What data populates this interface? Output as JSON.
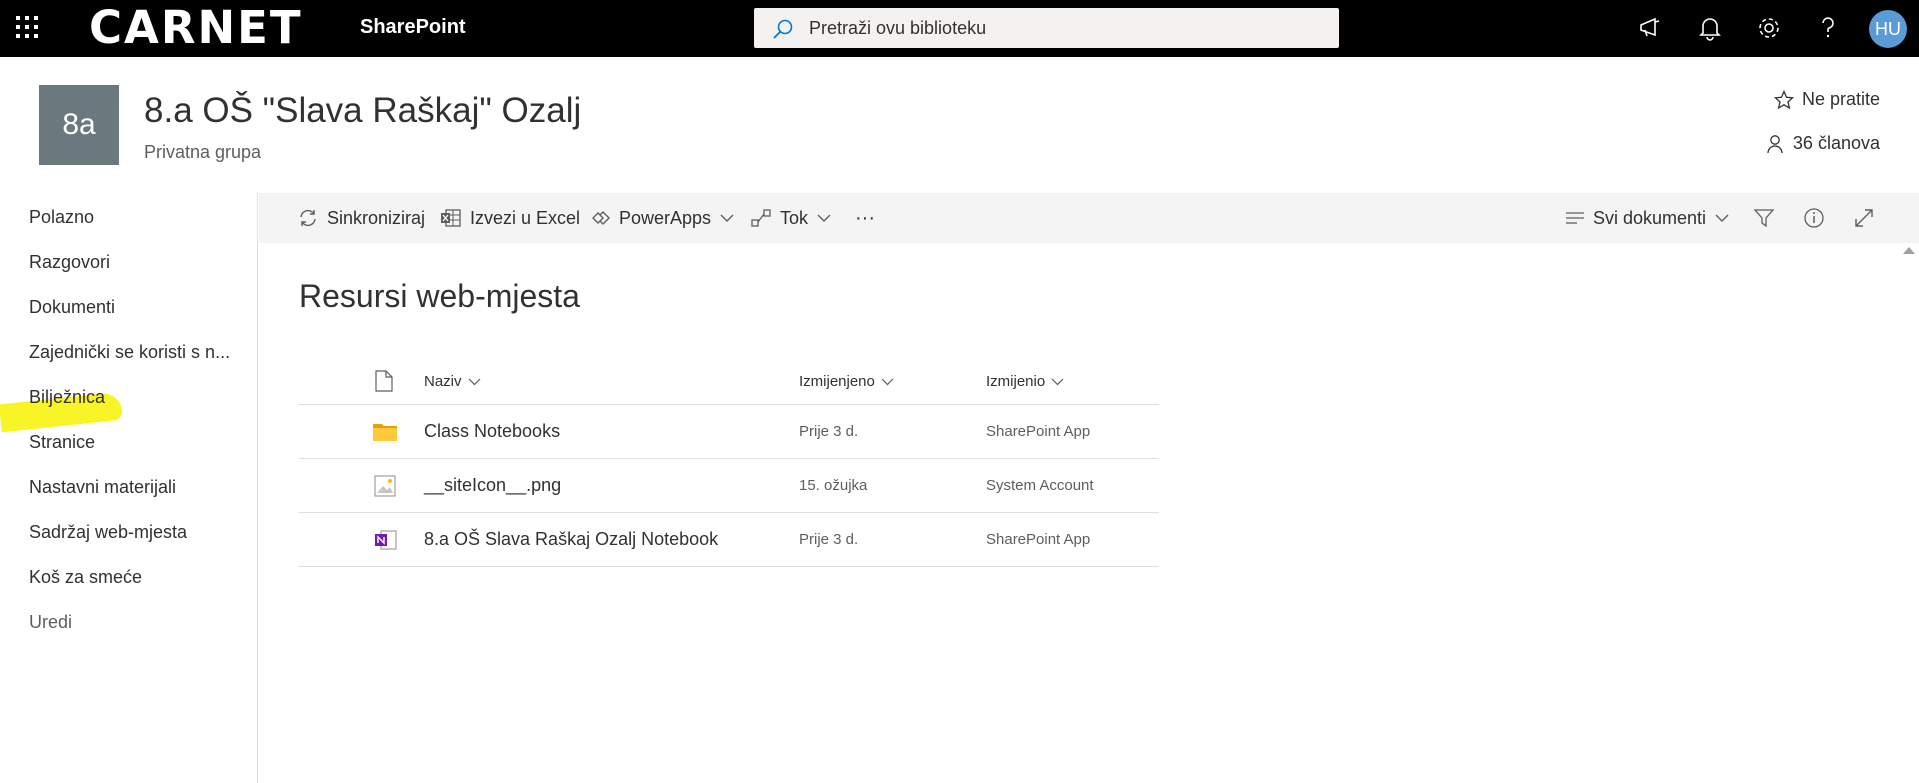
{
  "suitebar": {
    "brand": "CARNET",
    "app_name": "SharePoint",
    "search_placeholder": "Pretraži ovu biblioteku",
    "user_initials": "HU"
  },
  "site": {
    "logo_text": "8a",
    "title": "8.a OŠ \"Slava Raškaj\" Ozalj",
    "subtitle": "Privatna grupa",
    "follow_label": "Ne pratite",
    "members_label": "36 članova"
  },
  "nav": {
    "items": [
      {
        "label": "Polazno"
      },
      {
        "label": "Razgovori"
      },
      {
        "label": "Dokumenti"
      },
      {
        "label": "Zajednički se koristi s n..."
      },
      {
        "label": "Bilježnica"
      },
      {
        "label": "Stranice"
      },
      {
        "label": "Nastavni materijali"
      },
      {
        "label": "Sadržaj web-mjesta"
      },
      {
        "label": "Koš za smeće"
      }
    ],
    "edit_label": "Uredi"
  },
  "commands": {
    "sync": "Sinkroniziraj",
    "export_excel": "Izvezi u Excel",
    "powerapps": "PowerApps",
    "flow": "Tok",
    "more": "···",
    "view": "Svi dokumenti"
  },
  "page": {
    "title": "Resursi web-mjesta"
  },
  "list": {
    "columns": {
      "name": "Naziv",
      "modified": "Izmijenjeno",
      "modified_by": "Izmijenio"
    },
    "rows": [
      {
        "icon": "folder-icon",
        "name": "Class Notebooks",
        "modified": "Prije 3 d.",
        "modified_by": "SharePoint App"
      },
      {
        "icon": "image-file-icon",
        "name": "__siteIcon__.png",
        "modified": "15. ožujka",
        "modified_by": "System Account"
      },
      {
        "icon": "onenote-icon",
        "name": "8.a OŠ Slava Raškaj Ozalj Notebook",
        "modified": "Prije 3 d.",
        "modified_by": "SharePoint App"
      }
    ]
  },
  "colors": {
    "suitebar_bg": "#000000",
    "site_logo_bg": "#69797e",
    "avatar_bg": "#5b9bd5",
    "command_bar_bg": "#f4f4f4",
    "folder": "#ffb900",
    "onenote": "#7719aa",
    "highlighter": "#f8f200"
  }
}
